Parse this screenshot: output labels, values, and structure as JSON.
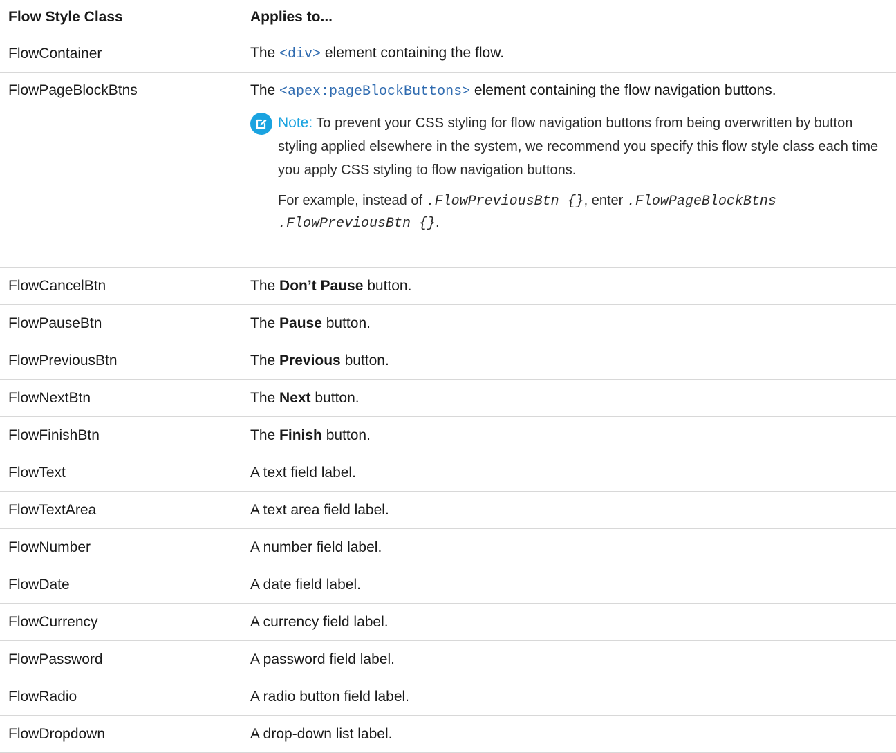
{
  "table": {
    "headers": {
      "class": "Flow Style Class",
      "applies": "Applies to..."
    },
    "row_container": {
      "class": "FlowContainer",
      "pre": "The ",
      "code": "<div>",
      "post": " element containing the flow."
    },
    "row_page_block": {
      "class": "FlowPageBlockBtns",
      "pre": "The ",
      "code": "<apex:pageBlockButtons>",
      "post": " element containing the flow navigation buttons.",
      "note": {
        "label": "Note:",
        "text": " To prevent your CSS styling for flow navigation buttons from being overwritten by button styling applied elsewhere in the system, we recommend you specify this flow style class each time you apply CSS styling to flow navigation buttons.",
        "example_pre": "For example, instead of ",
        "example_code1": ".FlowPreviousBtn {}",
        "example_mid": ", enter ",
        "example_code2": ".FlowPageBlockBtns .FlowPreviousBtn {}",
        "example_post": "."
      }
    },
    "button_rows": [
      {
        "class": "FlowCancelBtn",
        "pre": "The ",
        "bold": "Don’t Pause",
        "post": " button."
      },
      {
        "class": "FlowPauseBtn",
        "pre": "The ",
        "bold": "Pause",
        "post": " button."
      },
      {
        "class": "FlowPreviousBtn",
        "pre": "The ",
        "bold": "Previous",
        "post": " button."
      },
      {
        "class": "FlowNextBtn",
        "pre": "The ",
        "bold": "Next",
        "post": " button."
      },
      {
        "class": "FlowFinishBtn",
        "pre": "The ",
        "bold": "Finish",
        "post": " button."
      }
    ],
    "label_rows": [
      {
        "class": "FlowText",
        "desc": "A text field label."
      },
      {
        "class": "FlowTextArea",
        "desc": "A text area field label."
      },
      {
        "class": "FlowNumber",
        "desc": "A number field label."
      },
      {
        "class": "FlowDate",
        "desc": "A date field label."
      },
      {
        "class": "FlowCurrency",
        "desc": "A currency field label."
      },
      {
        "class": "FlowPassword",
        "desc": "A password field label."
      },
      {
        "class": "FlowRadio",
        "desc": "A radio button field label."
      },
      {
        "class": "FlowDropdown",
        "desc": "A drop-down list label."
      }
    ]
  },
  "colors": {
    "code": "#2f6bb0",
    "note_accent": "#1aa3e0"
  },
  "icons": {
    "note": "edit-note-icon"
  }
}
